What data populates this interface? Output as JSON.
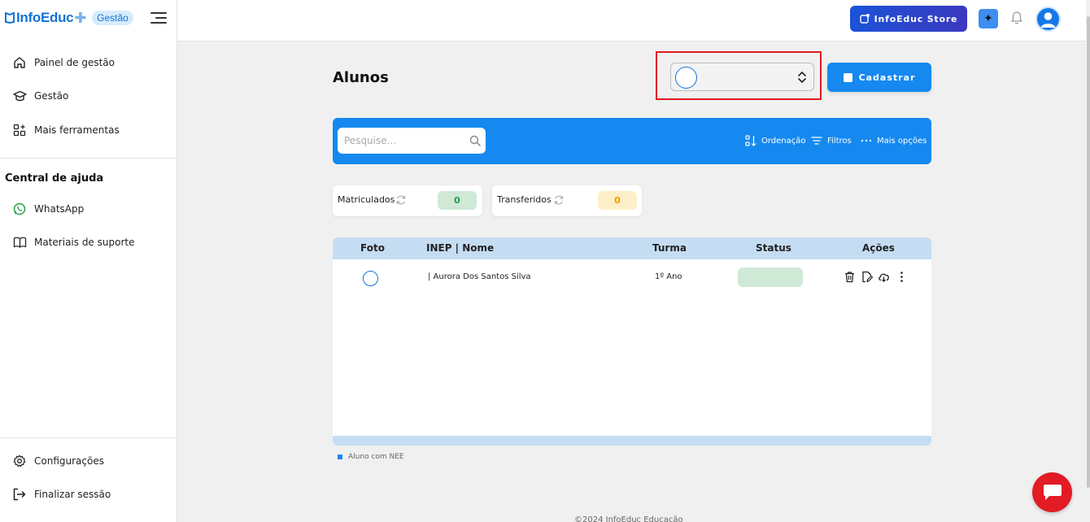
{
  "brand": {
    "name": "InfoEduc",
    "badge": "Gestão"
  },
  "sidebar": {
    "items": [
      {
        "label": "Painel de gestão",
        "icon": "home-icon"
      },
      {
        "label": "Gestão",
        "icon": "graduation-cap-icon"
      },
      {
        "label": "Mais ferramentas",
        "icon": "grid-plus-icon"
      }
    ],
    "help_title": "Central de ajuda",
    "help_items": [
      {
        "label": "WhatsApp",
        "icon": "whatsapp-icon"
      },
      {
        "label": "Materiais de suporte",
        "icon": "book-icon"
      }
    ],
    "bottom_items": [
      {
        "label": "Configurações",
        "icon": "gear-icon"
      },
      {
        "label": "Finalizar sessão",
        "icon": "logout-icon"
      }
    ]
  },
  "topbar": {
    "store_label": "InfoEduc Store",
    "spark_symbol": "✦"
  },
  "main": {
    "title": "Alunos",
    "cadastrar_label": "Cadastrar",
    "search_placeholder": "Pesquise...",
    "toolbar": {
      "ordenacao": "Ordenação",
      "filtros": "Filtros",
      "mais_opcoes": "Mais opções"
    },
    "stats": [
      {
        "label": "Matriculados",
        "value": "0",
        "bg": "#cfe9d6",
        "color": "#1f9d46"
      },
      {
        "label": "Transferidos",
        "value": "0",
        "bg": "#fdefc8",
        "color": "#e6a100"
      }
    ],
    "table": {
      "headers": {
        "foto": "Foto",
        "inep_nome": "INEP | Nome",
        "turma": "Turma",
        "status": "Status",
        "acoes": "Ações"
      },
      "rows": [
        {
          "inep_nome": "| Aurora Dos Santos Silva",
          "turma": "1º Ano",
          "status": ""
        }
      ]
    },
    "legend": "Aluno com NEE",
    "footer": "©2024 InfoEduc Educação"
  },
  "colors": {
    "primary": "#1589f0",
    "highlight": "#e0191c",
    "chat": "#e21b25"
  }
}
